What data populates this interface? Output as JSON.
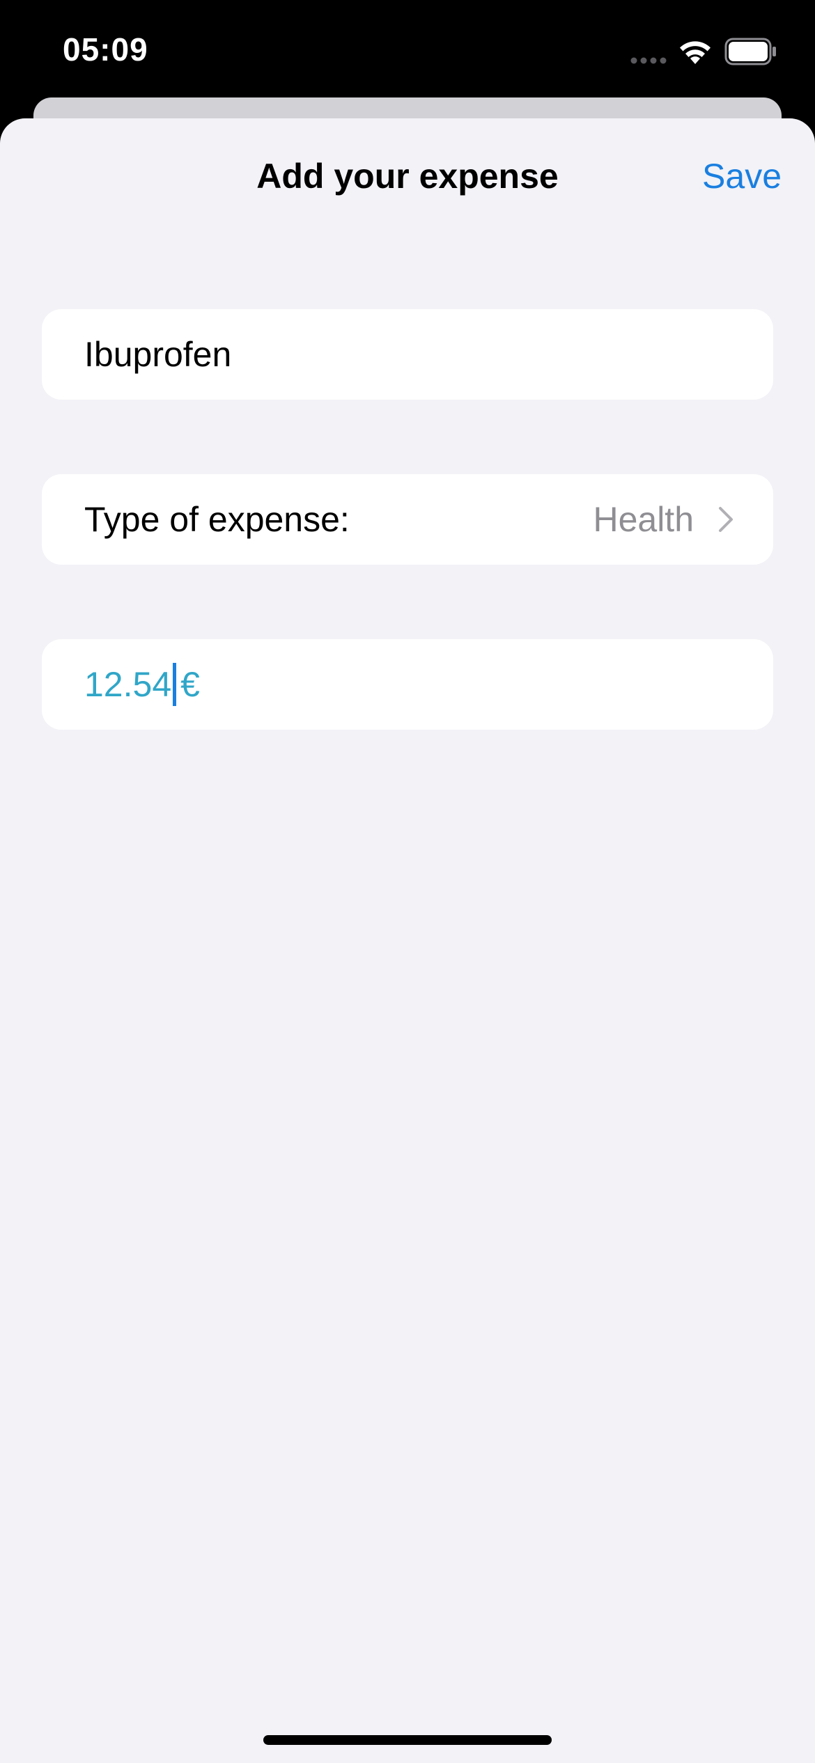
{
  "status_bar": {
    "time": "05:09",
    "signal_icon": "cellular-dots-icon",
    "wifi_icon": "wifi-icon",
    "battery_icon": "battery-icon"
  },
  "nav": {
    "title": "Add your expense",
    "save_label": "Save"
  },
  "form": {
    "name_value": "Ibuprofen",
    "type_label": "Type of expense:",
    "type_value": "Health",
    "type_icon": "chevron-right-icon",
    "amount_value": "12.54",
    "currency": "€"
  },
  "colors": {
    "accent": "#1a7fe0",
    "amount_text": "#30a6c8",
    "secondary_text": "#8e8e93",
    "background": "#f2f2f7",
    "card": "#ffffff"
  }
}
